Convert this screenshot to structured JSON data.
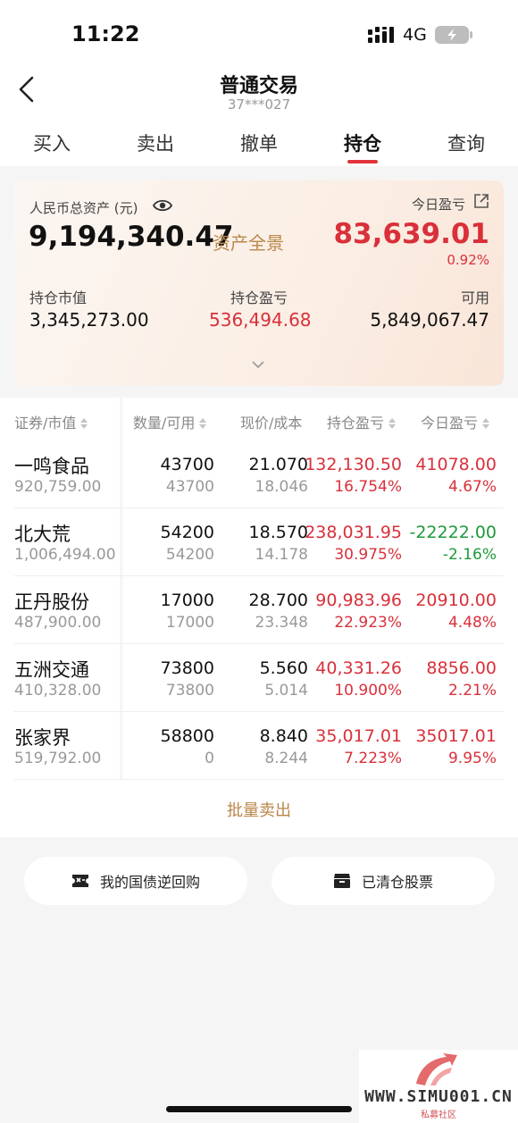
{
  "status": {
    "time": "11:22",
    "network": "4G"
  },
  "header": {
    "title": "普通交易",
    "account": "37***027"
  },
  "tabs": [
    {
      "label": "买入"
    },
    {
      "label": "卖出"
    },
    {
      "label": "撤单"
    },
    {
      "label": "持仓",
      "active": true
    },
    {
      "label": "查询"
    }
  ],
  "summary": {
    "total_label": "人民币总资产 (元)",
    "total_value": "9,194,340.47",
    "panorama_label": "资产全景",
    "today_label": "今日盈亏",
    "today_value": "83,639.01",
    "today_pct": "0.92%",
    "market_value_label": "持仓市值",
    "market_value": "3,345,273.00",
    "holding_pl_label": "持仓盈亏",
    "holding_pl": "536,494.68",
    "available_label": "可用",
    "available": "5,849,067.47"
  },
  "table": {
    "headers": {
      "stock": "证券/市值",
      "qty": "数量/可用",
      "price": "现价/成本",
      "pl": "持仓盈亏",
      "today": "今日盈亏"
    },
    "rows": [
      {
        "name": "一鸣食品",
        "market_value": "920,759.00",
        "qty": "43700",
        "available": "43700",
        "price": "21.070",
        "cost": "18.046",
        "pl": "132,130.50",
        "pl_pct": "16.754%",
        "today_pl": "41078.00",
        "today_pct": "4.67%"
      },
      {
        "name": "北大荒",
        "market_value": "1,006,494.00",
        "qty": "54200",
        "available": "54200",
        "price": "18.570",
        "cost": "14.178",
        "pl": "238,031.95",
        "pl_pct": "30.975%",
        "today_pl": "-22222.00",
        "today_pct": "-2.16%"
      },
      {
        "name": "正丹股份",
        "market_value": "487,900.00",
        "qty": "17000",
        "available": "17000",
        "price": "28.700",
        "cost": "23.348",
        "pl": "90,983.96",
        "pl_pct": "22.923%",
        "today_pl": "20910.00",
        "today_pct": "4.48%"
      },
      {
        "name": "五洲交通",
        "market_value": "410,328.00",
        "qty": "73800",
        "available": "73800",
        "price": "5.560",
        "cost": "5.014",
        "pl": "40,331.26",
        "pl_pct": "10.900%",
        "today_pl": "8856.00",
        "today_pct": "2.21%"
      },
      {
        "name": "张家界",
        "market_value": "519,792.00",
        "qty": "58800",
        "available": "0",
        "price": "8.840",
        "cost": "8.244",
        "pl": "35,017.01",
        "pl_pct": "7.223%",
        "today_pl": "35017.01",
        "today_pct": "9.95%"
      }
    ]
  },
  "actions": {
    "batch_sell": "批量卖出",
    "repo": "我的国债逆回购",
    "cleared": "已清仓股票"
  },
  "watermark": {
    "site": "WWW.SIMU001.CN",
    "sub": "私募社区"
  },
  "colors": {
    "up": "#d9303a",
    "down": "#1f9a3b",
    "accent": "#b8874a"
  }
}
